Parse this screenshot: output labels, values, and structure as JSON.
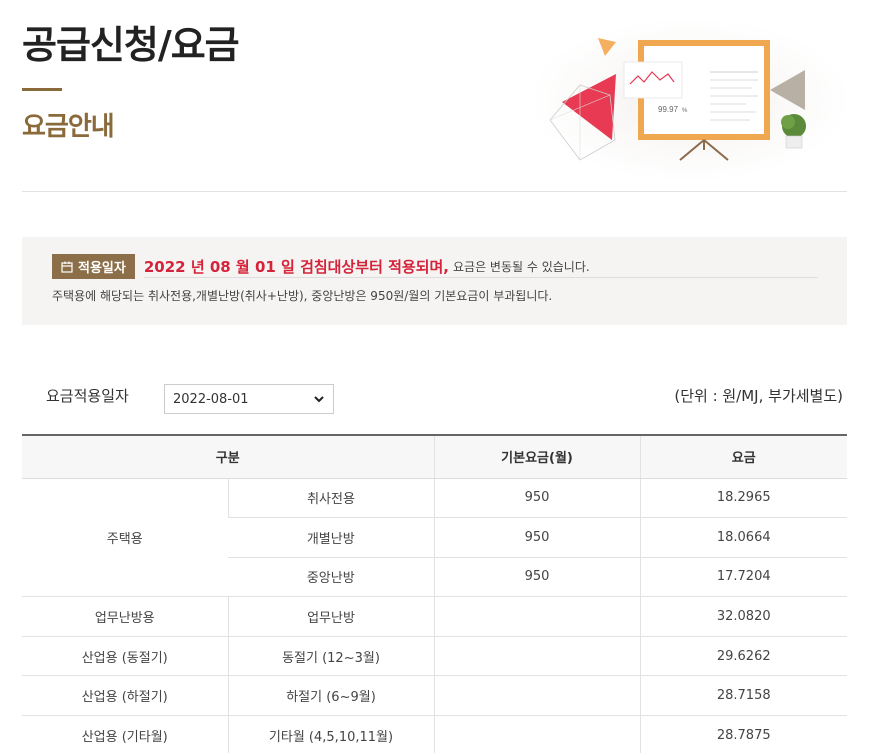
{
  "page": {
    "title": "공급신청/요금",
    "subtitle": "요금안내"
  },
  "notice": {
    "badge_label": "적용일자",
    "highlight": "2022 년 08 월 01 일 검침대상부터 적용되며,",
    "small_text": "요금은 변동될 수 있습니다.",
    "line2": "주택용에 해당되는 취사전용,개별난방(취사+난방), 중앙난방은 950원/월의 기본요금이 부과됩니다."
  },
  "filter": {
    "label": "요금적용일자",
    "selected_date": "2022-08-01",
    "unit_note": "(단위 : 원/MJ, 부가세별도)"
  },
  "table": {
    "headers": {
      "category": "구분",
      "base_fee": "기본요금(월)",
      "rate": "요금"
    },
    "group_residential": "주택용",
    "rows": [
      {
        "group": "주택용",
        "sub": "취사전용",
        "base": "950",
        "rate": "18.2965"
      },
      {
        "group": "주택용",
        "sub": "개별난방",
        "base": "950",
        "rate": "18.0664"
      },
      {
        "group": "주택용",
        "sub": "중앙난방",
        "base": "950",
        "rate": "17.7204"
      },
      {
        "group": "업무난방용",
        "sub": "업무난방",
        "base": "",
        "rate": "32.0820"
      },
      {
        "group": "산업용 (동절기)",
        "sub": "동절기 (12~3월)",
        "base": "",
        "rate": "29.6262"
      },
      {
        "group": "산업용 (하절기)",
        "sub": "하절기 (6~9월)",
        "base": "",
        "rate": "28.7158"
      },
      {
        "group": "산업용 (기타월)",
        "sub": "기타월 (4,5,10,11월)",
        "base": "",
        "rate": "28.7875"
      }
    ]
  },
  "illustration": {
    "percent_label": "99.97",
    "colors": {
      "board_frame": "#f0a850",
      "triangle_red": "#e83a52",
      "triangle_gray": "#b8b0a4",
      "triangle_orange": "#f4b060"
    }
  }
}
